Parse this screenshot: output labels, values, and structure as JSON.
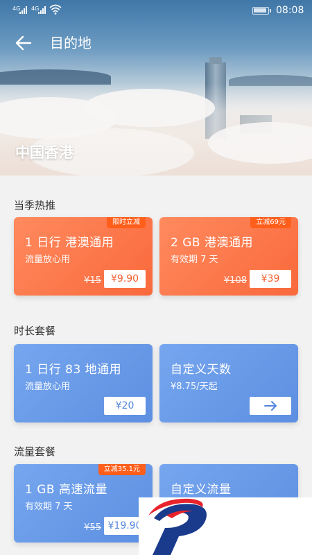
{
  "status_bar": {
    "signal_1": "4G",
    "signal_2": "4G",
    "time": "08:08"
  },
  "header": {
    "title": "目的地",
    "back_icon": "arrow-left-icon",
    "destination": "中国香港"
  },
  "sections": [
    {
      "title": "当季热推",
      "cards": [
        {
          "name": "1 日行  港澳通用",
          "sub": "流量放心用",
          "badge": "限时立减",
          "original_price": "¥15",
          "price": "¥9.90"
        },
        {
          "name": "2 GB 港澳通用",
          "sub": "有效期 7 天",
          "badge": "立减69元",
          "original_price": "¥108",
          "price": "¥39"
        }
      ]
    },
    {
      "title": "时长套餐",
      "cards": [
        {
          "name": "1 日行  83 地通用",
          "sub": "流量放心用",
          "price": "¥20"
        },
        {
          "name": "自定义天数",
          "sub": "¥8.75/天起",
          "action_icon": "arrow-right-icon"
        }
      ]
    },
    {
      "title": "流量套餐",
      "cards": [
        {
          "name": "1 GB 高速流量",
          "sub": "有效期 7 天",
          "badge": "立减35.1元",
          "original_price": "¥55",
          "price": "¥19.90"
        },
        {
          "name": "自定义流量"
        }
      ]
    }
  ],
  "colors": {
    "hot_card": "#f9693c",
    "plan_card": "#5d8fe2",
    "badge": "#ff5e1b",
    "background": "#f2f2f2",
    "logo_red": "#e8232b",
    "logo_blue": "#1a3a8c"
  }
}
